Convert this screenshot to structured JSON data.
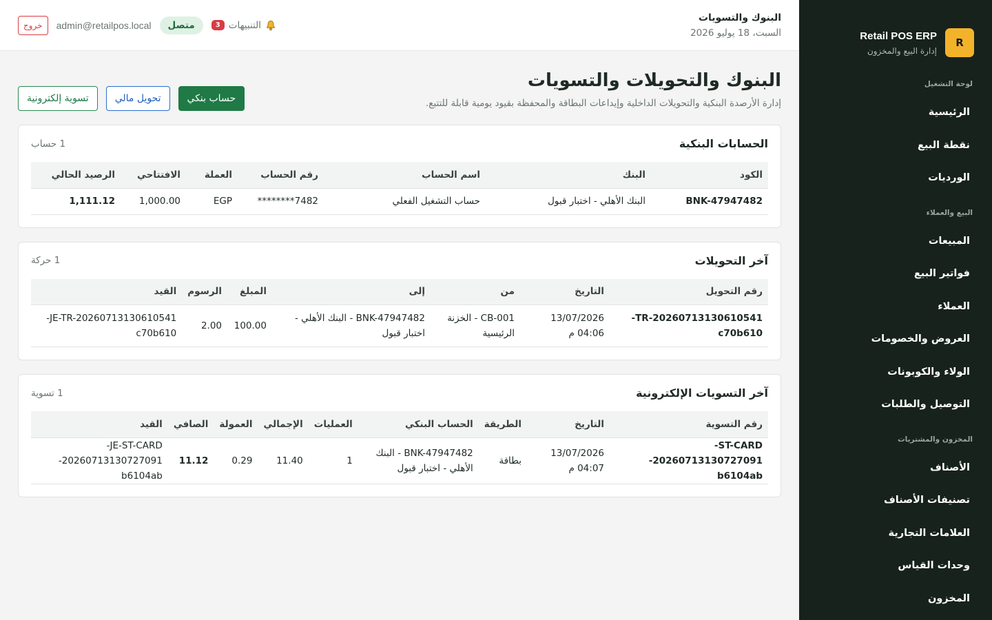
{
  "brand": {
    "logo_letter": "R",
    "name": "Retail POS ERP",
    "subtitle": "إدارة البيع والمخزون"
  },
  "sidebar": {
    "groups": [
      {
        "title": "لوحة التشغيل",
        "items": [
          "الرئيسية",
          "نقطة البيع",
          "الورديات"
        ]
      },
      {
        "title": "البيع والعملاء",
        "items": [
          "المبيعات",
          "فواتير البيع",
          "العملاء",
          "العروض والخصومات",
          "الولاء والكوبونات",
          "التوصيل والطلبات"
        ]
      },
      {
        "title": "المخزون والمشتريات",
        "items": [
          "الأصناف",
          "تصنيفات الأصناف",
          "العلامات التجارية",
          "وحدات القياس",
          "المخزون"
        ]
      }
    ]
  },
  "topbar": {
    "title": "البنوك والتسويات",
    "date": "السبت، 18 يوليو 2026",
    "notifications_label": "التنبيهات",
    "notifications_count": "3",
    "status": "متصل",
    "user_email": "admin@retailpos.local",
    "logout": "خروج"
  },
  "page": {
    "title": "البنوك والتحويلات والتسويات",
    "subtitle": "إدارة الأرصدة البنكية والتحويلات الداخلية وإيداعات البطاقة والمحفظة بقيود يومية قابلة للتتبع.",
    "buttons": {
      "bank_account": "حساب بنكي",
      "transfer": "تحويل مالي",
      "e_settlement": "تسوية إلكترونية"
    }
  },
  "bank_accounts": {
    "title": "الحسابات البنكية",
    "count": "1 حساب",
    "columns": [
      "الكود",
      "البنك",
      "اسم الحساب",
      "رقم الحساب",
      "العملة",
      "الافتتاحي",
      "الرصيد الحالي"
    ],
    "rows": [
      [
        "BNK-47947482",
        "البنك الأهلي - اختبار قبول",
        "حساب التشغيل الفعلي",
        "********7482",
        "EGP",
        "1,000.00",
        "1,111.12"
      ]
    ]
  },
  "transfers": {
    "title": "آخر التحويلات",
    "count": "1 حركة",
    "columns": [
      "رقم التحويل",
      "التاريخ",
      "من",
      "إلى",
      "المبلغ",
      "الرسوم",
      "القيد"
    ],
    "rows": [
      {
        "number_l1": "TR-20260713130610541-",
        "number_l2": "c70b610",
        "date_l1": "13/07/2026",
        "date_l2": "04:06 م",
        "from_l1": "CB-001 - الخزنة",
        "from_l2": "الرئيسية",
        "to_l1": "BNK-47947482 - البنك الأهلي -",
        "to_l2": "اختبار قبول",
        "amount": "100.00",
        "fees": "2.00",
        "entry_l1": "JE-TR-20260713130610541-",
        "entry_l2": "c70b610"
      }
    ]
  },
  "settlements": {
    "title": "آخر التسويات الإلكترونية",
    "count": "1 تسوية",
    "columns": [
      "رقم التسوية",
      "التاريخ",
      "الطريقة",
      "الحساب البنكي",
      "العمليات",
      "الإجمالي",
      "العمولة",
      "الصافي",
      "القيد"
    ],
    "rows": [
      {
        "number_l1": "ST-CARD-",
        "number_l2": "20260713130727091-b6104ab",
        "date_l1": "13/07/2026",
        "date_l2": "04:07 م",
        "method": "بطاقة",
        "account_l1": "BNK-47947482 - البنك",
        "account_l2": "الأهلي - اختبار قبول",
        "operations": "1",
        "total": "11.40",
        "commission": "0.29",
        "net": "11.12",
        "entry_l1": "JE-ST-CARD-",
        "entry_l2": "20260713130727091-b6104ab"
      }
    ]
  },
  "colors": {
    "sidebar_bg": "#17221d",
    "brand_accent": "#f2b32a",
    "primary": "#1f7a45",
    "danger": "#d93c43",
    "link_blue": "#1f5fbf"
  }
}
